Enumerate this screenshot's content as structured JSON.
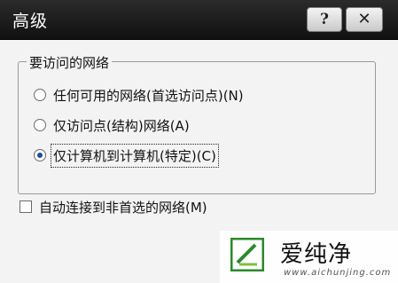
{
  "window": {
    "title": "高级",
    "help_glyph": "?",
    "close_glyph": "✕"
  },
  "group": {
    "label": "要访问的网络",
    "options": [
      {
        "label": "任何可用的网络(首选访问点)(N)",
        "selected": false
      },
      {
        "label": "仅访问点(结构)网络(A)",
        "selected": false
      },
      {
        "label": "仅计算机到计算机(特定)(C)",
        "selected": true
      }
    ]
  },
  "auto_connect": {
    "label": "自动连接到非首选的网络(M)",
    "checked": false
  },
  "watermark": {
    "name": "爱纯净",
    "url": "www.aichunjing.com"
  }
}
